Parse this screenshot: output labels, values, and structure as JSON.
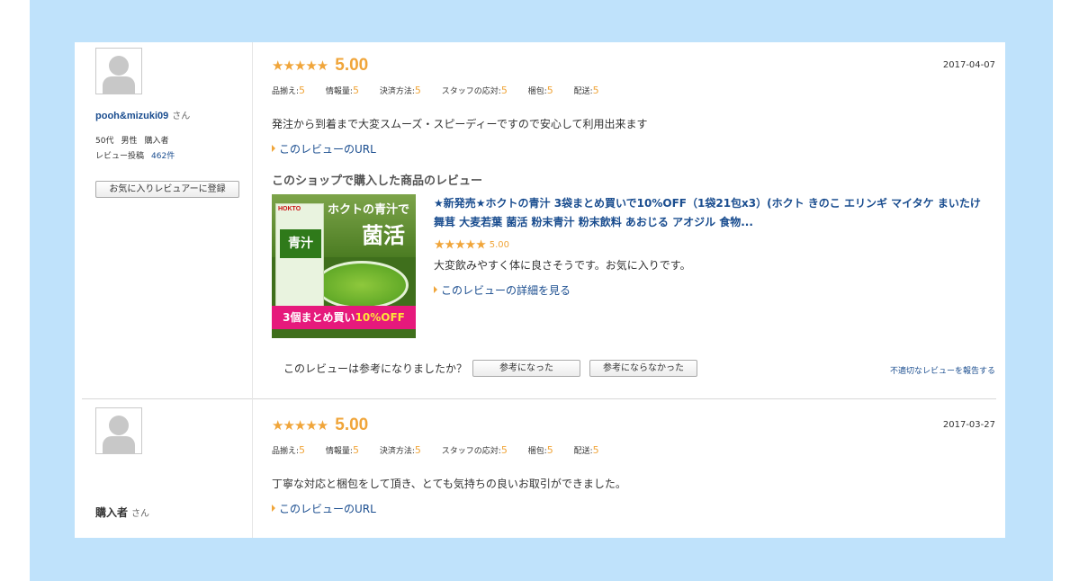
{
  "reviews": [
    {
      "username": "pooh&mizuki09",
      "honorific": "さん",
      "age": "50代",
      "gender": "男性",
      "buyer_type": "購入者",
      "review_count_label": "レビュー投稿",
      "review_count": "462件",
      "favorite_button": "お気に入りレビュアーに登録",
      "stars": "★★★★★",
      "score": "5.00",
      "date": "2017-04-07",
      "sub_ratings": [
        {
          "label": "品揃え:",
          "value": "5"
        },
        {
          "label": "情報量:",
          "value": "5"
        },
        {
          "label": "決済方法:",
          "value": "5"
        },
        {
          "label": "スタッフの応対:",
          "value": "5"
        },
        {
          "label": "梱包:",
          "value": "5"
        },
        {
          "label": "配送:",
          "value": "5"
        }
      ],
      "comment": "発注から到着まで大変スムーズ・スピーディーですので安心して利用出来ます",
      "url_link": "このレビューのURL",
      "shop_heading": "このショップで購入した商品のレビュー",
      "product": {
        "image_logo": "HOKTO",
        "image_pack_text": "青汁",
        "image_title1": "ホクトの青汁で",
        "image_title2": "菌活",
        "image_banner_pre": "3個まとめ買い",
        "image_banner_highlight": "10%OFF",
        "title": "★新発売★ホクトの青汁 3袋まとめ買いで10%OFF（1袋21包x3）(ホクト きのこ エリンギ マイタケ まいたけ 舞茸 大麦若葉 菌活 粉末青汁 粉末飲料 あおじる アオジル 食物...",
        "stars": "★★★★★",
        "score": "5.00",
        "comment": "大変飲みやすく体に良さそうです。お気に入りです。",
        "detail_link": "このレビューの詳細を見る"
      },
      "helpful_question": "このレビューは参考になりましたか？",
      "helpful_yes": "参考になった",
      "helpful_no": "参考にならなかった",
      "report_link": "不適切なレビューを報告する"
    },
    {
      "username": "購入者",
      "honorific": "さん",
      "stars": "★★★★★",
      "score": "5.00",
      "date": "2017-03-27",
      "sub_ratings": [
        {
          "label": "品揃え:",
          "value": "5"
        },
        {
          "label": "情報量:",
          "value": "5"
        },
        {
          "label": "決済方法:",
          "value": "5"
        },
        {
          "label": "スタッフの応対:",
          "value": "5"
        },
        {
          "label": "梱包:",
          "value": "5"
        },
        {
          "label": "配送:",
          "value": "5"
        }
      ],
      "comment": "丁寧な対応と梱包をして頂き、とても気持ちの良いお取引ができました。",
      "url_link": "このレビューのURL"
    }
  ],
  "colors": {
    "page_background": "#bfe2fb",
    "star": "#f0a53a",
    "link": "#1a4d8f"
  }
}
